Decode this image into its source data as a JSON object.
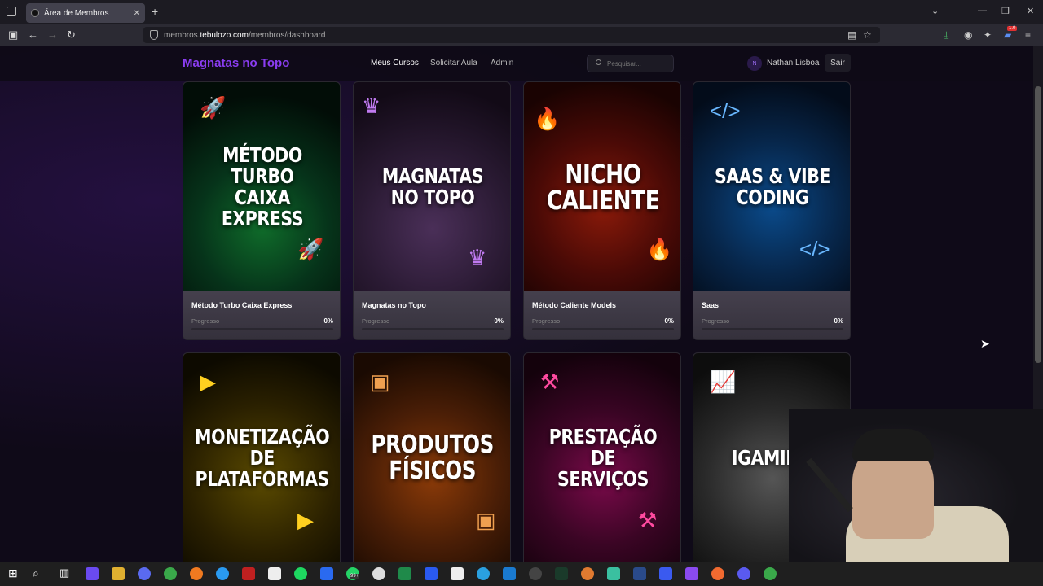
{
  "browser": {
    "tab_title": "Área de Membros",
    "tab_close": "✕",
    "new_tab": "+",
    "url_prefix": "membros.",
    "url_domain": "tebulozo.com",
    "url_path": "/membros/dashboard",
    "badge": "1.0"
  },
  "site": {
    "logo": "Magnatas no Topo",
    "nav": [
      {
        "label": "Meus Cursos"
      },
      {
        "label": "Solicitar Aula"
      },
      {
        "label": "Admin"
      }
    ],
    "search_placeholder": "Pesquisar...",
    "avatar_initial": "N",
    "user_name": "Nathan Lisboa",
    "logout": "Sair"
  },
  "courses": [
    {
      "art": "MÉTODO TURBO CAIXA EXPRESS",
      "title": "Método Turbo Caixa Express",
      "progress_label": "Progresso",
      "progress_text": "0%",
      "progress": 0,
      "theme": "green"
    },
    {
      "art": "MAGNATAS NO TOPO",
      "title": "Magnatas no Topo",
      "progress_label": "Progresso",
      "progress_text": "0%",
      "progress": 0,
      "theme": "purple"
    },
    {
      "art": "NICHO CALIENTE",
      "title": "Método Caliente Models",
      "progress_label": "Progresso",
      "progress_text": "0%",
      "progress": 0,
      "theme": "fire"
    },
    {
      "art": "SAAS & VIBE CODING",
      "title": "Saas",
      "progress_label": "Progresso",
      "progress_text": "0%",
      "progress": 0,
      "theme": "blue"
    },
    {
      "art": "MONETIZAÇÃO DE PLATAFORMAS",
      "theme": "yellow"
    },
    {
      "art": "PRODUTOS FÍSICOS",
      "theme": "orange"
    },
    {
      "art": "PRESTAÇÃO DE SERVIÇOS",
      "theme": "pink"
    },
    {
      "art": "IGAMING",
      "theme": "gray"
    }
  ],
  "taskbar": {
    "notif_badge": "99+"
  }
}
